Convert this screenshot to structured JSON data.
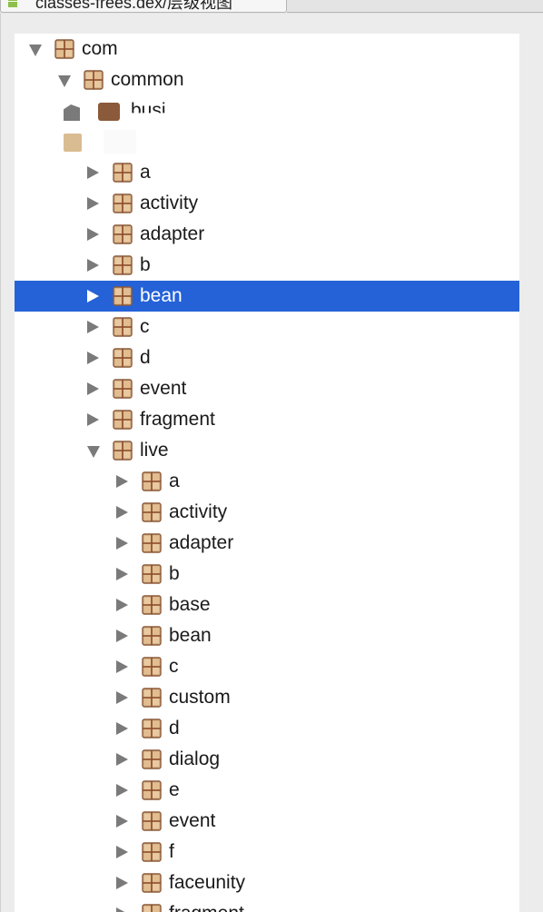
{
  "tab": {
    "label": "classes-frees.dex/层级视图",
    "icon": "android-icon"
  },
  "tree": {
    "selected_color": "#2562d8",
    "rows": [
      {
        "label": "com",
        "level": 0,
        "state": "expanded"
      },
      {
        "label": "common",
        "level": 1,
        "state": "expanded"
      },
      {
        "label": "busi",
        "level": 2,
        "state": "collapsed-obscured"
      },
      {
        "label": "",
        "level": 2,
        "state": "obscured"
      },
      {
        "label": "a",
        "level": 2,
        "state": "collapsed"
      },
      {
        "label": "activity",
        "level": 2,
        "state": "collapsed"
      },
      {
        "label": "adapter",
        "level": 2,
        "state": "collapsed"
      },
      {
        "label": "b",
        "level": 2,
        "state": "collapsed"
      },
      {
        "label": "bean",
        "level": 2,
        "state": "collapsed",
        "selected": true
      },
      {
        "label": "c",
        "level": 2,
        "state": "collapsed"
      },
      {
        "label": "d",
        "level": 2,
        "state": "collapsed"
      },
      {
        "label": "event",
        "level": 2,
        "state": "collapsed"
      },
      {
        "label": "fragment",
        "level": 2,
        "state": "collapsed"
      },
      {
        "label": "live",
        "level": 2,
        "state": "expanded"
      },
      {
        "label": "a",
        "level": 3,
        "state": "collapsed"
      },
      {
        "label": "activity",
        "level": 3,
        "state": "collapsed"
      },
      {
        "label": "adapter",
        "level": 3,
        "state": "collapsed"
      },
      {
        "label": "b",
        "level": 3,
        "state": "collapsed"
      },
      {
        "label": "base",
        "level": 3,
        "state": "collapsed"
      },
      {
        "label": "bean",
        "level": 3,
        "state": "collapsed"
      },
      {
        "label": "c",
        "level": 3,
        "state": "collapsed"
      },
      {
        "label": "custom",
        "level": 3,
        "state": "collapsed"
      },
      {
        "label": "d",
        "level": 3,
        "state": "collapsed"
      },
      {
        "label": "dialog",
        "level": 3,
        "state": "collapsed"
      },
      {
        "label": "e",
        "level": 3,
        "state": "collapsed"
      },
      {
        "label": "event",
        "level": 3,
        "state": "collapsed"
      },
      {
        "label": "f",
        "level": 3,
        "state": "collapsed"
      },
      {
        "label": "faceunity",
        "level": 3,
        "state": "collapsed"
      },
      {
        "label": "fragment",
        "level": 3,
        "state": "collapsed"
      }
    ]
  }
}
